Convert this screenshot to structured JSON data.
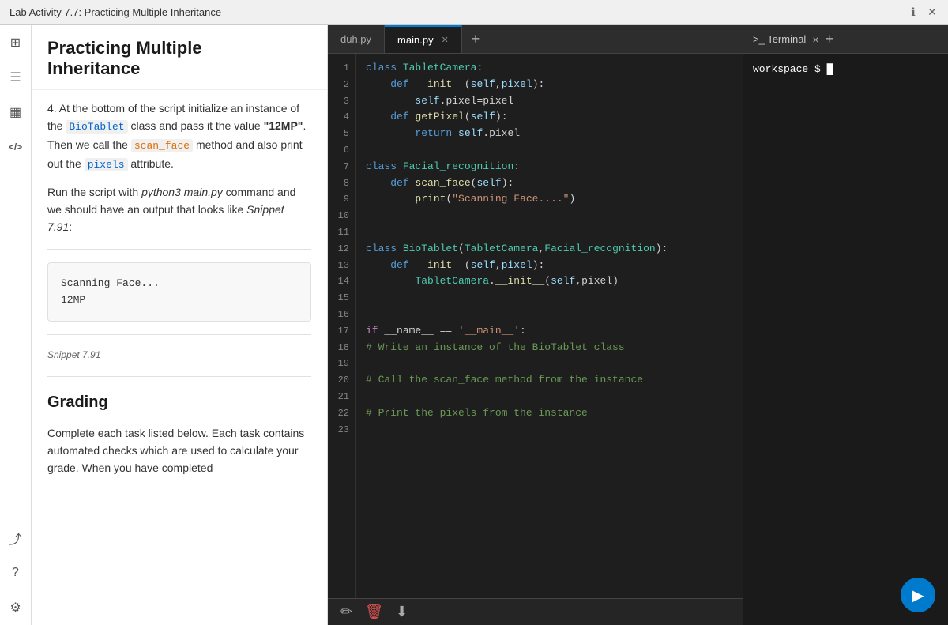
{
  "titleBar": {
    "title": "Lab Activity 7.7: Practicing Multiple Inheritance",
    "infoIcon": "ℹ",
    "closeIcon": "✕"
  },
  "sidebarIcons": [
    {
      "name": "panels-icon",
      "glyph": "⊞"
    },
    {
      "name": "list-icon",
      "glyph": "≡"
    },
    {
      "name": "chart-icon",
      "glyph": "▦"
    },
    {
      "name": "code-icon",
      "glyph": "</>"
    },
    {
      "name": "share-icon",
      "glyph": "⤴"
    },
    {
      "name": "help-icon",
      "glyph": "?"
    },
    {
      "name": "settings-icon",
      "glyph": "⚙"
    }
  ],
  "contentPanel": {
    "title": "Practicing Multiple Inheritance",
    "bodyText": {
      "para1_prefix": "4. At the bottom of the script initialize an instance of the",
      "bioTablet_class": "BioTablet",
      "para1_mid": "class and pass it the value",
      "para1_bold": "\"12MP\"",
      "para1_suffix": ". Then we call the",
      "scan_face_method": "scan_face",
      "para1_end": "method and also print out the",
      "pixels_attr": "pixels",
      "para1_final": "attribute."
    },
    "para2": "Run the script with",
    "para2_italic": "python3 main.py",
    "para2_suffix": "command and we should have an output that looks like",
    "snippet_ref_italic": "Snippet 7.91",
    "snippet_ref_suffix": ":",
    "snippetOutput": {
      "line1": "Scanning Face...",
      "line2": "12MP"
    },
    "snippetLabel": "Snippet 7.91",
    "gradingHeading": "Grading",
    "gradingText": "Complete each task listed below. Each task contains automated checks which are used to calculate your grade. When you have completed"
  },
  "editor": {
    "tabs": [
      {
        "label": "duh.py",
        "active": false
      },
      {
        "label": "main.py",
        "active": true
      }
    ],
    "addTabIcon": "+",
    "codeLines": [
      {
        "num": 1,
        "content": "class TabletCamera:"
      },
      {
        "num": 2,
        "content": "    def __init__(self,pixel):"
      },
      {
        "num": 3,
        "content": "        self.pixel=pixel"
      },
      {
        "num": 4,
        "content": "    def getPixel(self):"
      },
      {
        "num": 5,
        "content": "        return self.pixel"
      },
      {
        "num": 6,
        "content": ""
      },
      {
        "num": 7,
        "content": "class Facial_recognition:"
      },
      {
        "num": 8,
        "content": "    def scan_face(self):"
      },
      {
        "num": 9,
        "content": "        print(\"Scanning Face....\")"
      },
      {
        "num": 10,
        "content": ""
      },
      {
        "num": 11,
        "content": ""
      },
      {
        "num": 12,
        "content": "class BioTablet(TabletCamera,Facial_recognition):"
      },
      {
        "num": 13,
        "content": "    def __init__(self,pixel):"
      },
      {
        "num": 14,
        "content": "        TabletCamera.__init__(self,pixel)"
      },
      {
        "num": 15,
        "content": ""
      },
      {
        "num": 16,
        "content": ""
      },
      {
        "num": 17,
        "content": "if __name__ == '__main__':"
      },
      {
        "num": 18,
        "content": "# Write an instance of the BioTablet class"
      },
      {
        "num": 19,
        "content": ""
      },
      {
        "num": 20,
        "content": "# Call the scan_face method from the instance"
      },
      {
        "num": 21,
        "content": ""
      },
      {
        "num": 22,
        "content": "# Print the pixels from the instance"
      },
      {
        "num": 23,
        "content": ""
      }
    ],
    "footerIcons": {
      "edit": "✏",
      "delete": "🗑",
      "download": "⬇"
    }
  },
  "terminal": {
    "title": ">_ Terminal",
    "closeIcon": "×",
    "addIcon": "+",
    "prompt": "workspace",
    "promptSymbol": "$",
    "cursor": "█"
  },
  "playButton": {
    "icon": "▶"
  }
}
